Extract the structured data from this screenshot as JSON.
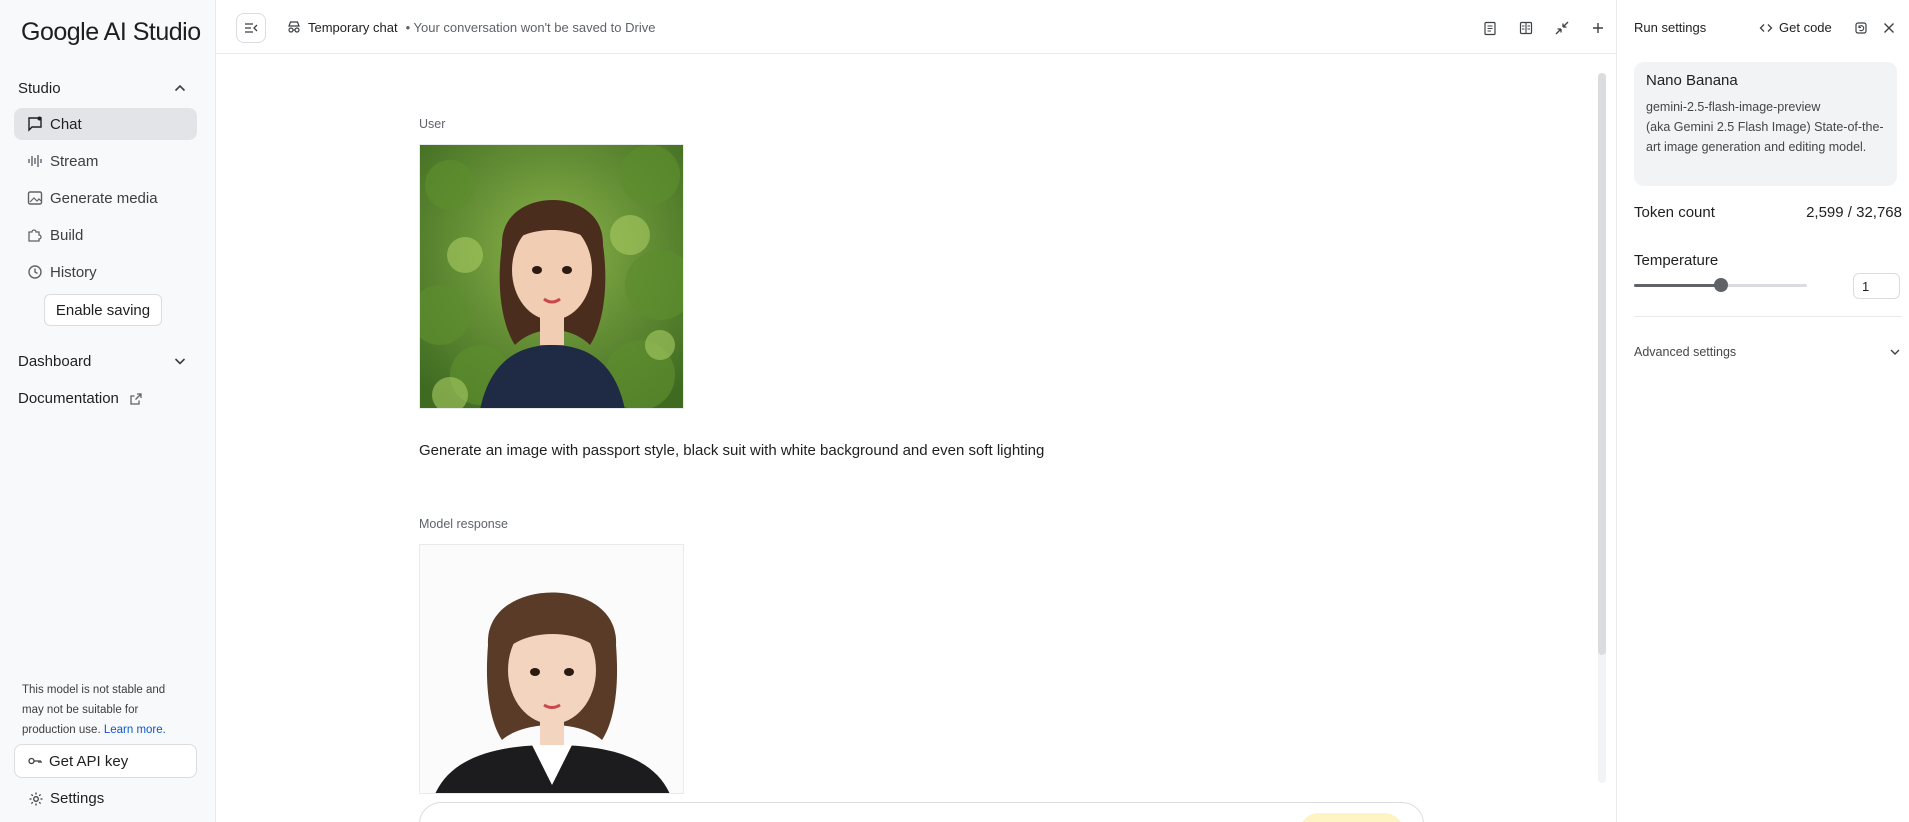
{
  "app": {
    "logo_text": "Google AI Studio"
  },
  "sidebar": {
    "studio_label": "Studio",
    "items": [
      {
        "label": "Chat",
        "icon": "chat-icon",
        "active": true
      },
      {
        "label": "Stream",
        "icon": "audio-wave-icon",
        "active": false
      },
      {
        "label": "Generate media",
        "icon": "image-icon",
        "active": false
      },
      {
        "label": "Build",
        "icon": "puzzle-icon",
        "active": false
      },
      {
        "label": "History",
        "icon": "history-icon",
        "active": false
      }
    ],
    "enable_saving_label": "Enable saving",
    "dashboard_label": "Dashboard",
    "documentation_label": "Documentation",
    "warning_text": "This model is not stable and may not be suitable for production use.",
    "learn_more_label": "Learn more.",
    "api_key_label": "Get API key",
    "settings_label": "Settings"
  },
  "topbar": {
    "chat_title": "Temporary chat",
    "chat_subtitle": "• Your conversation won't be saved to Drive",
    "icons": [
      "clipboard-icon",
      "compare-icon",
      "compress-icon",
      "add-icon"
    ]
  },
  "conversation": {
    "user_label": "User",
    "user_prompt": "Generate an image with passport style, black suit with white background and even soft lighting",
    "model_label": "Model response"
  },
  "run_settings": {
    "title": "Run settings",
    "get_code_label": "Get code",
    "model": {
      "name": "Nano Banana",
      "id": "gemini-2.5-flash-image-preview",
      "description": "(aka Gemini 2.5 Flash Image) State-of-the-art image generation and editing model."
    },
    "token_label": "Token count",
    "token_value": "2,599 / 32,768",
    "temperature_label": "Temperature",
    "temperature_value": "1",
    "temperature_fraction": 0.5,
    "advanced_label": "Advanced settings"
  },
  "colors": {
    "accent_link": "#0b57d0",
    "active_nav_bg": "#e2e4e7",
    "run_button_bg": "#fdf3c3"
  }
}
